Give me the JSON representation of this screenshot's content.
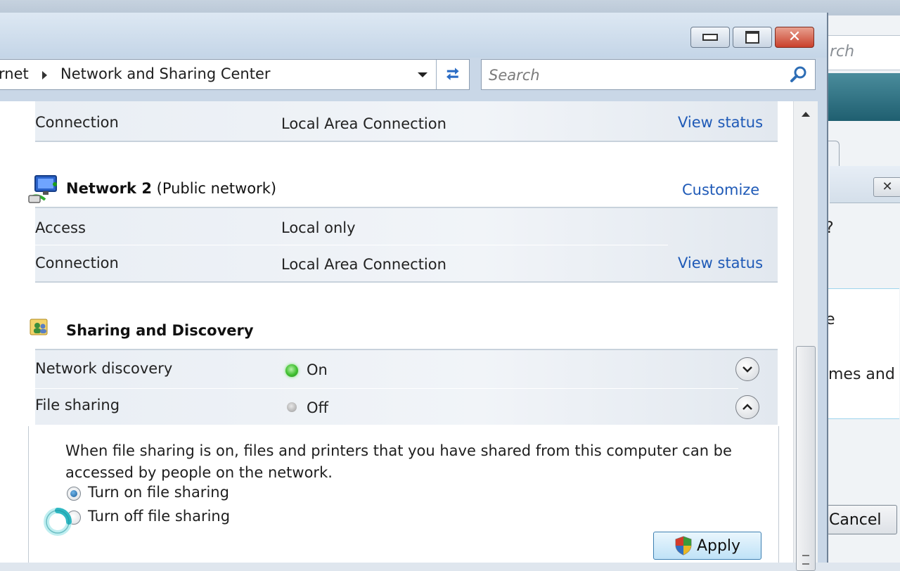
{
  "background": {
    "search_fragment": "rch",
    "frag_text_1": "?",
    "frag_text_2": "e",
    "frag_text_3": "mes and",
    "cancel_label": "Cancel"
  },
  "window": {
    "controls": {
      "minimize": "minimize",
      "maximize": "maximize",
      "close": "close"
    }
  },
  "address": {
    "crumb_prev": "rnet",
    "crumb_current": "Network and Sharing Center"
  },
  "search": {
    "placeholder": "Search"
  },
  "network1": {
    "connection_label": "Connection",
    "connection_value": "Local Area Connection",
    "view_status": "View status"
  },
  "network2": {
    "name": "Network  2",
    "type": "(Public network)",
    "customize": "Customize",
    "access_label": "Access",
    "access_value": "Local only",
    "connection_label": "Connection",
    "connection_value": "Local Area Connection",
    "view_status": "View status"
  },
  "sharing": {
    "title": "Sharing and Discovery",
    "network_discovery_label": "Network discovery",
    "network_discovery_value": "On",
    "file_sharing_label": "File sharing",
    "file_sharing_value": "Off",
    "description": "When file sharing is on, files and printers that you have shared from this computer can be accessed by people on the network.",
    "option_on": "Turn on file sharing",
    "option_off": "Turn off file sharing",
    "selected_option": "Turn on file sharing",
    "apply": "Apply"
  },
  "colors": {
    "link": "#1f5ab7",
    "status_on": "#3fbf2f",
    "status_off": "#8a8a8a"
  }
}
